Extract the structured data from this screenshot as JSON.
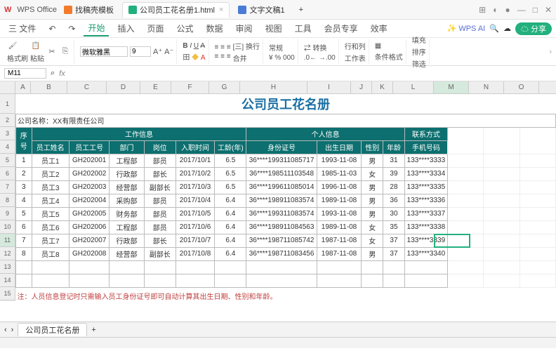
{
  "titlebar": {
    "logo": "W",
    "apptitle": "WPS Office",
    "tabs": [
      {
        "icon": "#f27b2b",
        "label": "找稿壳模板"
      },
      {
        "icon": "#22b07d",
        "label": "公司员工花名册1.html",
        "active": true
      },
      {
        "icon": "#4a7bd6",
        "label": "文字文稿1"
      }
    ],
    "plus": "+"
  },
  "menubar": {
    "filebtn": "三 文件",
    "items": [
      "开始",
      "插入",
      "页面",
      "公式",
      "数据",
      "审阅",
      "视图",
      "工具",
      "会员专享",
      "效率"
    ],
    "active": 0,
    "ai": "✨ WPS AI",
    "share": "☁ 分享"
  },
  "toolbar": {
    "fmtpaint": "格式刷",
    "paste": "粘贴",
    "font": "微软雅黑",
    "size": "9",
    "wrap": "[三] 换行",
    "merge": "合并",
    "numfmt": "常规",
    "rowcol": "行和列",
    "worksheet": "工作表",
    "condfmt": "条件格式",
    "fill": "填充",
    "sort": "排序",
    "filter": "筛选"
  },
  "namebox": {
    "cell": "M11",
    "fx": "fx"
  },
  "cols": [
    "A",
    "B",
    "C",
    "D",
    "E",
    "F",
    "G",
    "H",
    "I",
    "J",
    "K",
    "L",
    "M",
    "N",
    "O"
  ],
  "rows": [
    "1",
    "2",
    "3",
    "4",
    "5",
    "6",
    "7",
    "8",
    "9",
    "10",
    "11",
    "12",
    "13",
    "14",
    "15"
  ],
  "sheet": {
    "title": "公司员工花名册",
    "company": "公司名称：XX有限责任公司",
    "h_seq": "序号",
    "h_work": "工作信息",
    "h_personal": "个人信息",
    "h_contact": "联系方式",
    "sub": [
      "员工姓名",
      "员工工号",
      "部门",
      "岗位",
      "入职时间",
      "工龄(年)",
      "身份证号",
      "出生日期",
      "性别",
      "年龄",
      "手机号码"
    ],
    "data": [
      [
        "1",
        "员工1",
        "GH202001",
        "工程部",
        "部员",
        "2017/10/1",
        "6.5",
        "36****199311085717",
        "1993-11-08",
        "男",
        "31",
        "133****3333"
      ],
      [
        "2",
        "员工2",
        "GH202002",
        "行政部",
        "部长",
        "2017/10/2",
        "6.5",
        "36****198511103548",
        "1985-11-03",
        "女",
        "39",
        "133****3334"
      ],
      [
        "3",
        "员工3",
        "GH202003",
        "经营部",
        "副部长",
        "2017/10/3",
        "6.5",
        "36****199611085014",
        "1996-11-08",
        "男",
        "28",
        "133****3335"
      ],
      [
        "4",
        "员工4",
        "GH202004",
        "采购部",
        "部员",
        "2017/10/4",
        "6.4",
        "36****198911083574",
        "1989-11-08",
        "男",
        "36",
        "133****3336"
      ],
      [
        "5",
        "员工5",
        "GH202005",
        "财务部",
        "部员",
        "2017/10/5",
        "6.4",
        "36****199311083574",
        "1993-11-08",
        "男",
        "30",
        "133****3337"
      ],
      [
        "6",
        "员工6",
        "GH202006",
        "工程部",
        "部员",
        "2017/10/6",
        "6.4",
        "36****198911084563",
        "1989-11-08",
        "女",
        "35",
        "133****3338"
      ],
      [
        "7",
        "员工7",
        "GH202007",
        "行政部",
        "部长",
        "2017/10/7",
        "6.4",
        "36****198711085742",
        "1987-11-08",
        "女",
        "37",
        "133****3339"
      ],
      [
        "8",
        "员工8",
        "GH202008",
        "经营部",
        "副部长",
        "2017/10/8",
        "6.4",
        "36****198711083456",
        "1987-11-08",
        "男",
        "37",
        "133****3340"
      ]
    ],
    "note": "注：人员信息登记时只需输入员工身份证号即可自动计算其出生日期、性别和年龄。"
  },
  "sheettab": "公司员工花名册",
  "plus": "+"
}
